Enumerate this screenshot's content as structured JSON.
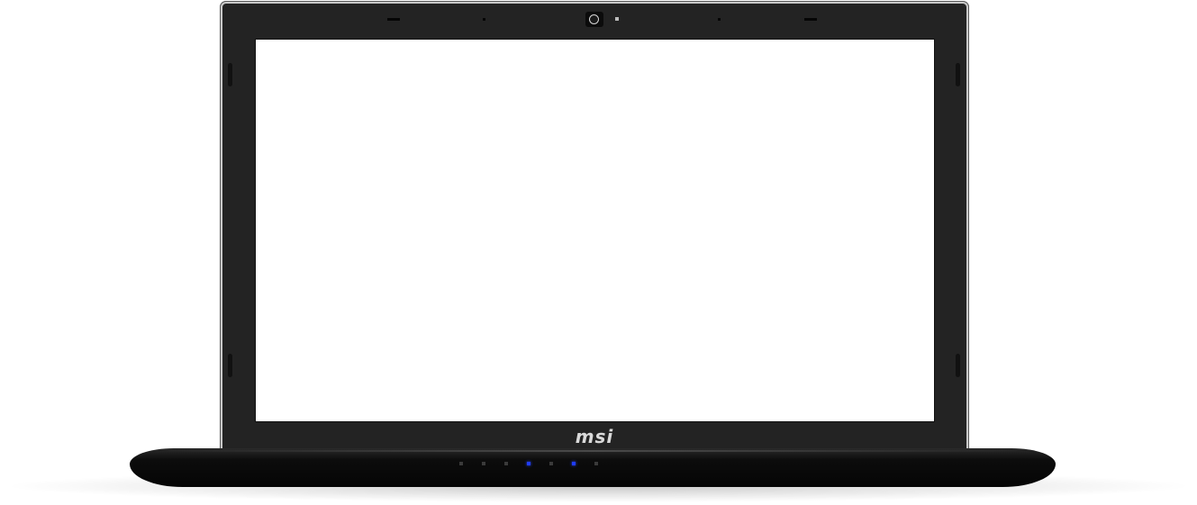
{
  "device": {
    "brand_logo": "msi",
    "screen_color": "#ffffff",
    "bezel_color": "#232323",
    "led_on_color": "#1f3cff"
  },
  "status_leds": [
    {
      "name": "led-1",
      "on": false
    },
    {
      "name": "led-2",
      "on": false
    },
    {
      "name": "led-3",
      "on": false
    },
    {
      "name": "led-4",
      "on": true
    },
    {
      "name": "led-5",
      "on": false
    },
    {
      "name": "led-6",
      "on": true
    },
    {
      "name": "led-7",
      "on": false
    }
  ]
}
